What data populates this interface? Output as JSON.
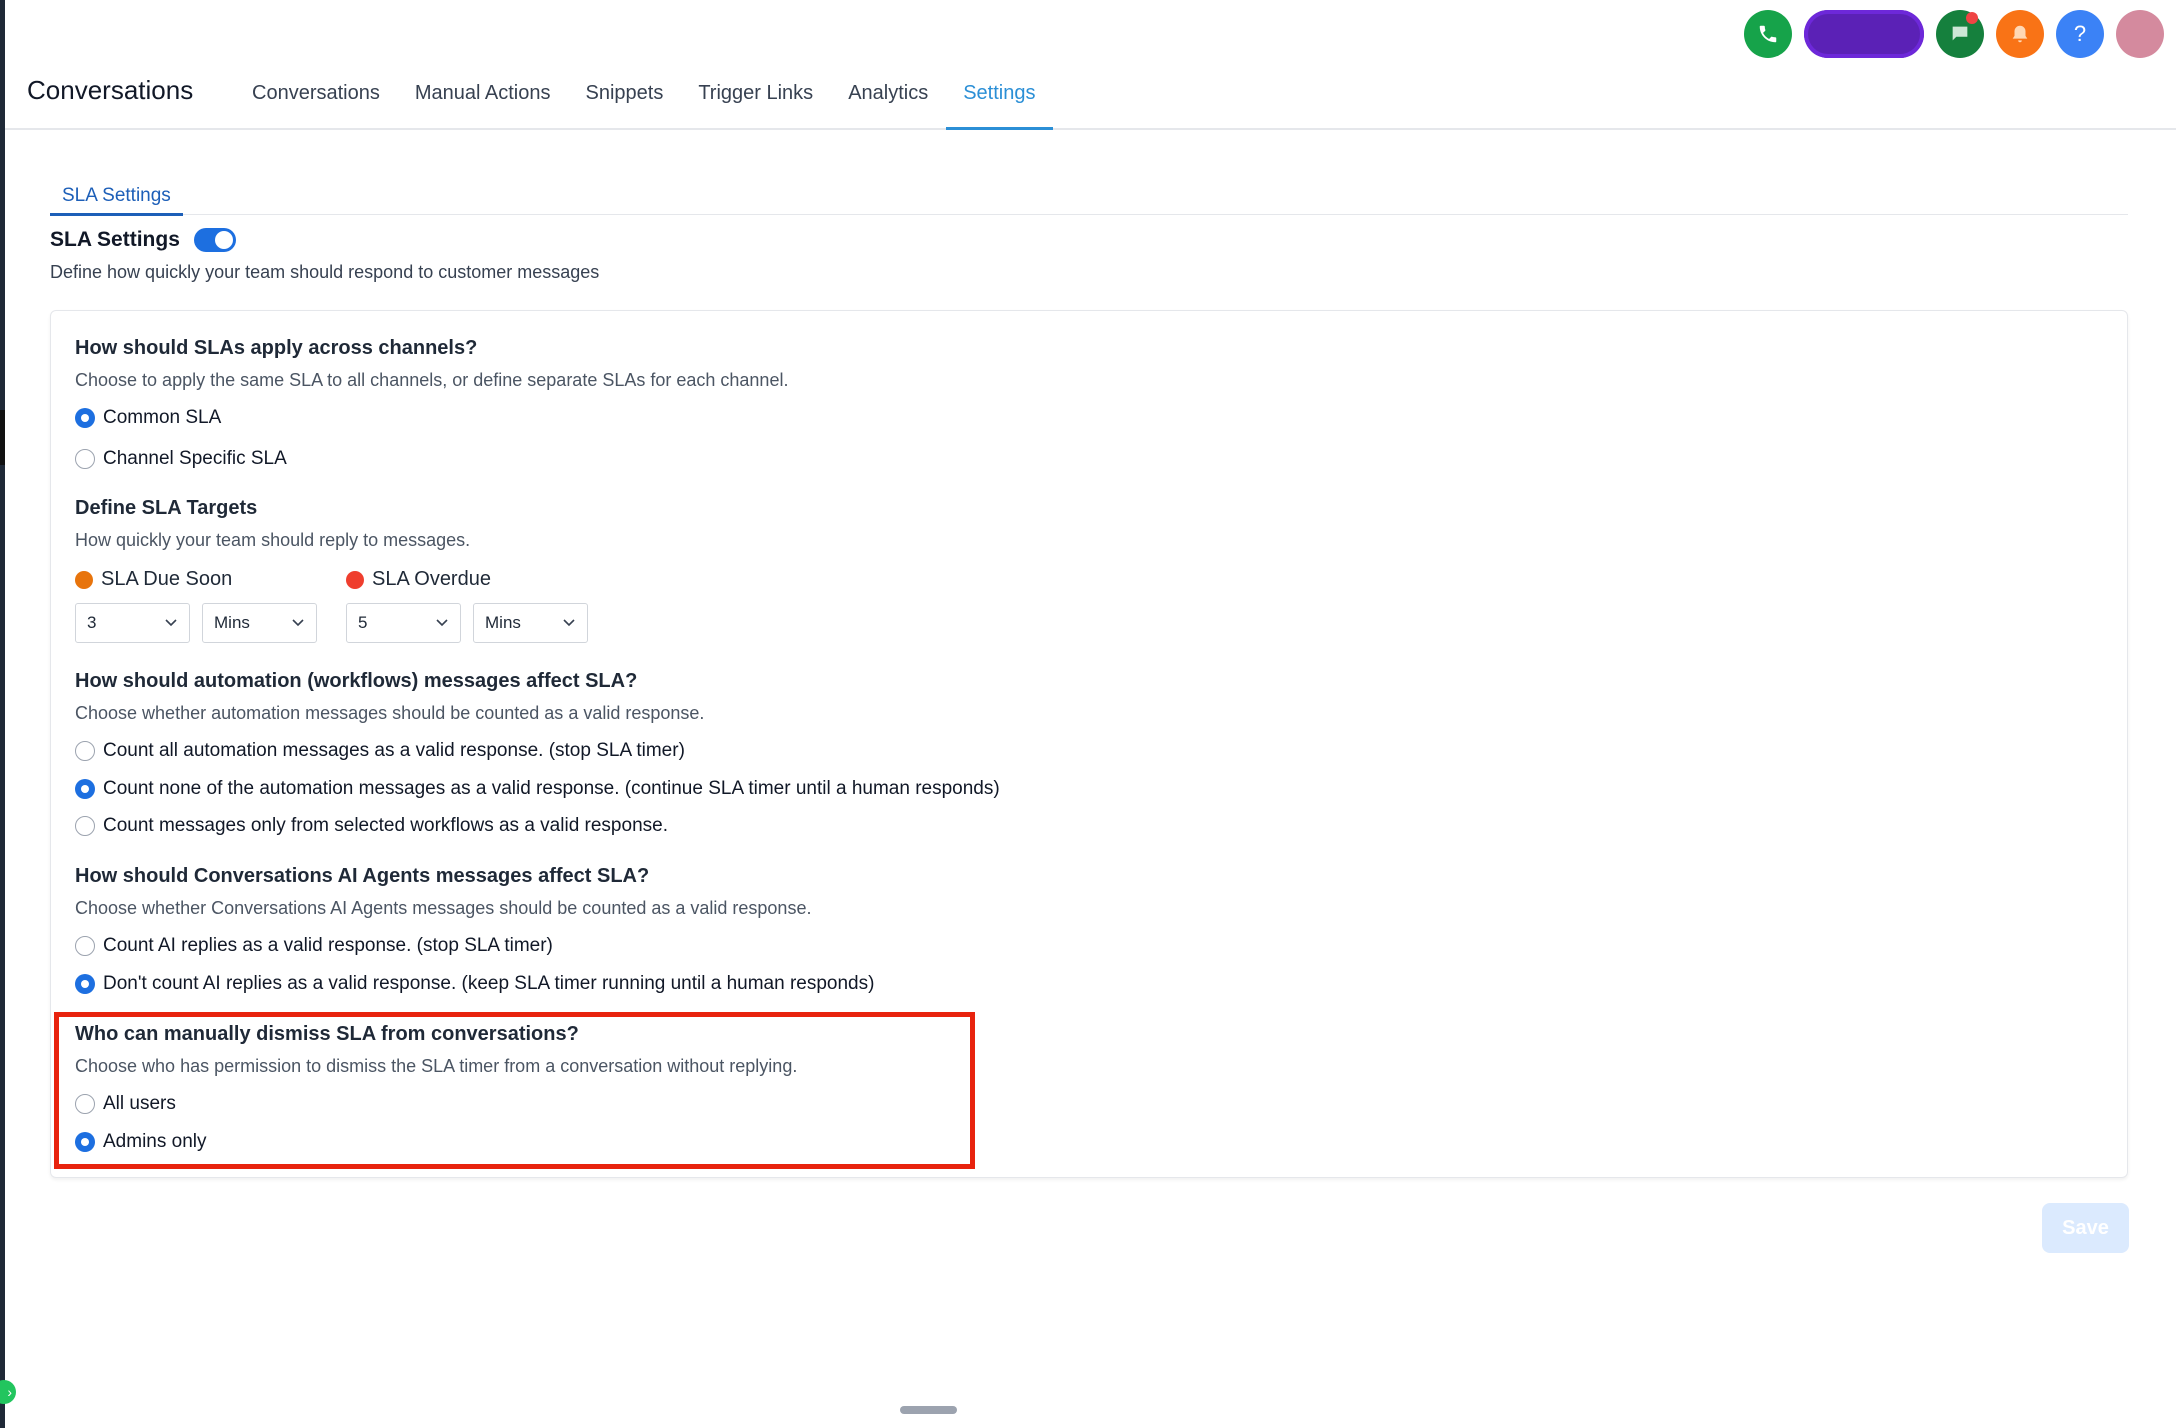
{
  "top_icons": {
    "phone": "phone-icon",
    "pill_label": "",
    "chat": "chat-icon",
    "notification": "bell-icon",
    "help": "help-icon",
    "avatar": "avatar"
  },
  "header": {
    "title": "Conversations",
    "tabs": [
      "Conversations",
      "Manual Actions",
      "Snippets",
      "Trigger Links",
      "Analytics",
      "Settings"
    ],
    "active_tab": "Settings"
  },
  "subtabs": [
    "SLA Settings"
  ],
  "sla": {
    "title": "SLA Settings",
    "enabled": true,
    "description": "Define how quickly your team should respond to customer messages"
  },
  "channels": {
    "title": "How should SLAs apply across channels?",
    "description": "Choose to apply the same SLA to all channels, or define separate SLAs for each channel.",
    "options": [
      "Common SLA",
      "Channel Specific SLA"
    ],
    "selected": "Common SLA"
  },
  "targets": {
    "title": "Define SLA Targets",
    "description": "How quickly your team should reply to messages.",
    "due_soon": {
      "label": "SLA Due Soon",
      "color": "#e8740c",
      "value": "3",
      "unit": "Mins"
    },
    "overdue": {
      "label": "SLA Overdue",
      "color": "#ef3e2e",
      "value": "5",
      "unit": "Mins"
    }
  },
  "automation": {
    "title": "How should automation (workflows) messages affect SLA?",
    "description": "Choose whether automation messages should be counted as a valid response.",
    "options": [
      "Count all automation messages as a valid response. (stop SLA timer)",
      "Count none of the automation messages as a valid response. (continue SLA timer until a human responds)",
      "Count messages only from selected workflows as a valid response."
    ],
    "selected_index": 1
  },
  "ai_agents": {
    "title": "How should Conversations AI Agents messages affect SLA?",
    "description": "Choose whether Conversations AI Agents messages should be counted as a valid response.",
    "options": [
      "Count AI replies as a valid response. (stop SLA timer)",
      "Don't count AI replies as a valid response. (keep SLA timer running until a human responds)"
    ],
    "selected_index": 1
  },
  "dismiss": {
    "title": "Who can manually dismiss SLA from conversations?",
    "description": "Choose who has permission to dismiss the SLA timer from a conversation without replying.",
    "options": [
      "All users",
      "Admins only"
    ],
    "selected_index": 1
  },
  "save_label": "Save",
  "colors": {
    "accent": "#1d6fe0",
    "active_tab": "#2b8fd6",
    "highlight": "#e8230e"
  }
}
